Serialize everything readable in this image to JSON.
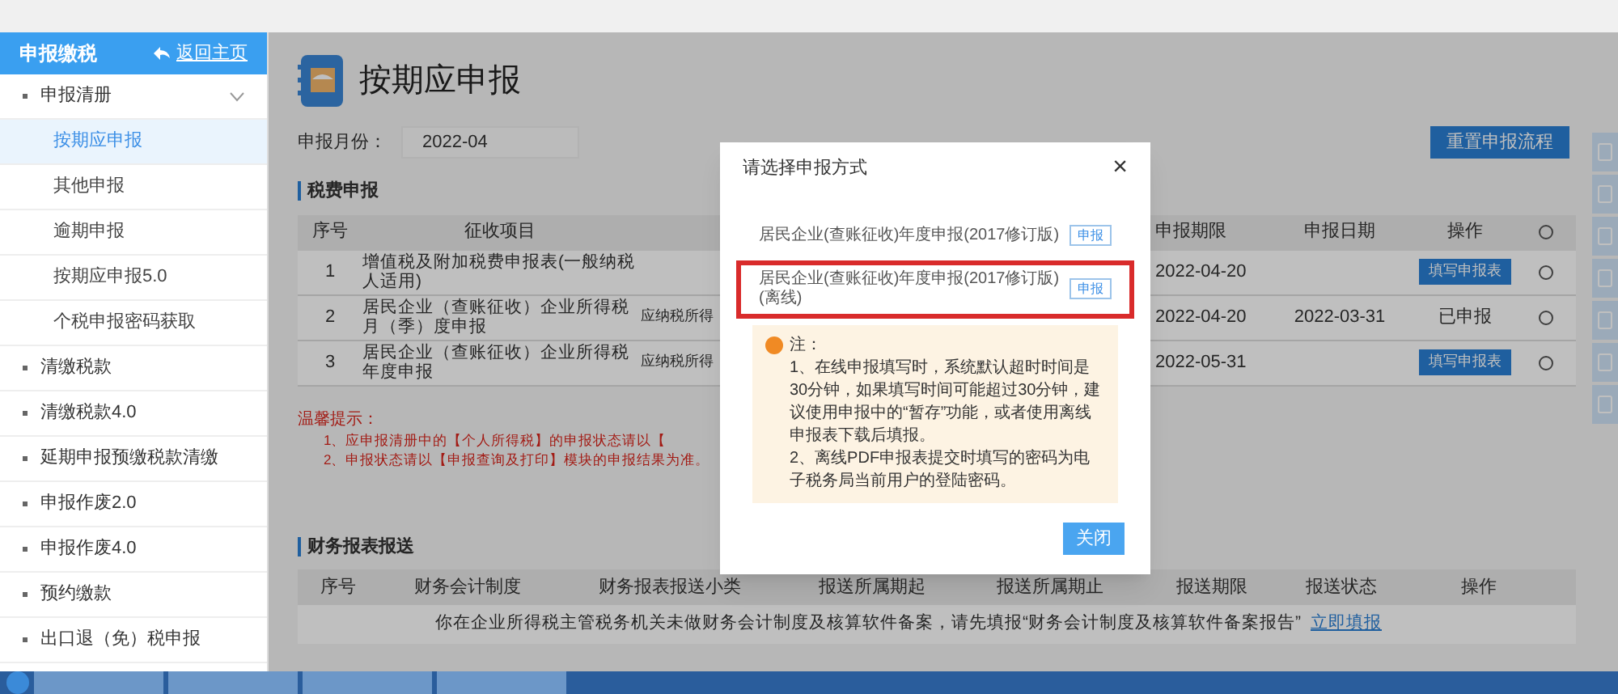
{
  "sidebar": {
    "title": "申报缴税",
    "home_link": "返回主页",
    "items": [
      {
        "label": "申报清册",
        "expanded": true,
        "children": [
          {
            "label": "按期应申报",
            "selected": true
          },
          {
            "label": "其他申报",
            "selected": false
          },
          {
            "label": "逾期申报",
            "selected": false
          },
          {
            "label": "按期应申报5.0",
            "selected": false
          },
          {
            "label": "个税申报密码获取",
            "selected": false
          }
        ]
      },
      {
        "label": "清缴税款"
      },
      {
        "label": "清缴税款4.0"
      },
      {
        "label": "延期申报预缴税款清缴"
      },
      {
        "label": "申报作废2.0"
      },
      {
        "label": "申报作废4.0"
      },
      {
        "label": "预约缴款"
      },
      {
        "label": "出口退（免）税申报"
      }
    ]
  },
  "page": {
    "title": "按期应申报",
    "month_label": "申报月份：",
    "month_value": "2022-04",
    "reset_button": "重置申报流程"
  },
  "tax_section": {
    "title": "税费申报",
    "columns": [
      "序号",
      "征收项目",
      "申报期限",
      "申报日期",
      "操作"
    ],
    "rows": [
      {
        "no": "1",
        "item": "增值税及附加税费申报表(一般纳税人适用)",
        "column_3": "",
        "deadline": "2022-04-20",
        "date": "",
        "action": {
          "kind": "button",
          "label": "填写申报表"
        },
        "selected": false
      },
      {
        "no": "2",
        "item": "居民企业（查账征收）企业所得税月（季）度申报",
        "column_3": "应纳税所得",
        "deadline": "2022-04-20",
        "date": "2022-03-31",
        "action": {
          "kind": "text",
          "label": "已申报"
        },
        "selected": false
      },
      {
        "no": "3",
        "item": "居民企业（查账征收）企业所得税年度申报",
        "column_3": "应纳税所得",
        "deadline": "2022-05-31",
        "date": "",
        "action": {
          "kind": "button",
          "label": "填写申报表"
        },
        "selected": false
      }
    ]
  },
  "reminder": {
    "title": "温馨提示：",
    "lines": [
      "1、应申报清册中的【个人所得税】的申报状态请以【",
      "2、申报状态请以【申报查询及打印】模块的申报结果为准。"
    ]
  },
  "finance_section": {
    "title": "财务报表报送",
    "columns": [
      "序号",
      "财务会计制度",
      "财务报表报送小类",
      "报送所属期起",
      "报送所属期止",
      "报送期限",
      "报送状态",
      "操作"
    ],
    "notice": "你在企业所得税主管税务机关未做财务会计制度及核算软件备案，请先填报“财务会计制度及核算软件备案报告”",
    "notice_link": "立即填报"
  },
  "dialog": {
    "title": "请选择申报方式",
    "close": "×",
    "options": [
      {
        "label": "居民企业(查账征收)年度申报(2017修订版)",
        "button": "申报",
        "highlighted": false
      },
      {
        "label": "居民企业(查账征收)年度申报(2017修订版)(离线)",
        "button": "申报",
        "highlighted": true
      }
    ],
    "note_title": "注：",
    "note_lines": [
      "1、在线申报填写时，系统默认超时时间是30分钟，如果填写时间可能超过30分钟，建议使用申报中的“暂存”功能，或者使用离线申报表下载后填报。",
      "2、离线PDF申报表提交时填写的密码为电子税务局当前用户的登陆密码。"
    ],
    "close_button": "关闭"
  }
}
